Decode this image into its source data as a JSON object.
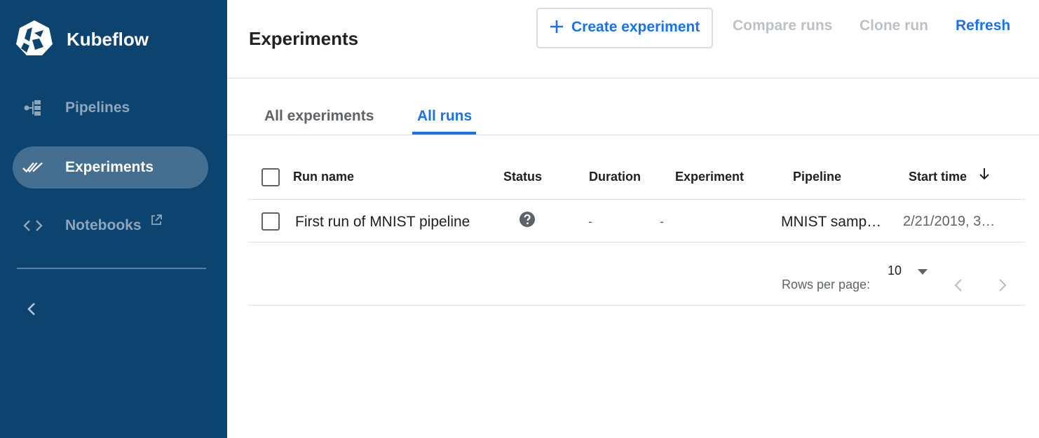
{
  "brand": {
    "name": "Kubeflow",
    "logo_icon": "kubeflow-logo"
  },
  "sidebar": {
    "items": [
      {
        "label": "Pipelines",
        "icon": "pipeline-icon",
        "active": false
      },
      {
        "label": "Experiments",
        "icon": "double-check-icon",
        "active": true
      },
      {
        "label": "Notebooks",
        "icon": "code-brackets-icon",
        "active": false,
        "external": true
      }
    ],
    "collapse_icon": "chevron-left-icon"
  },
  "header": {
    "title": "Experiments",
    "create_label": "Create experiment",
    "compare_label": "Compare runs",
    "clone_label": "Clone run",
    "refresh_label": "Refresh"
  },
  "tabs": [
    {
      "label": "All experiments",
      "active": false
    },
    {
      "label": "All runs",
      "active": true
    }
  ],
  "table": {
    "columns": [
      "Run name",
      "Status",
      "Duration",
      "Experiment",
      "Pipeline",
      "Start time"
    ],
    "sort_column": "Start time",
    "sort_direction": "descending",
    "rows": [
      {
        "run_name": "First run of MNIST pipeline",
        "status_icon": "question-circle-icon",
        "duration": "-",
        "experiment": "-",
        "pipeline": "MNIST samp…",
        "start_time": "2/21/2019, 3…"
      }
    ]
  },
  "pagination": {
    "rows_per_page_label": "Rows per page:",
    "rows_per_page": "10"
  },
  "colors": {
    "sidebar_bg": "#0c436f",
    "sidebar_active": "#456f91",
    "accent": "#1a73e8",
    "disabled": "#bdc1c6"
  }
}
